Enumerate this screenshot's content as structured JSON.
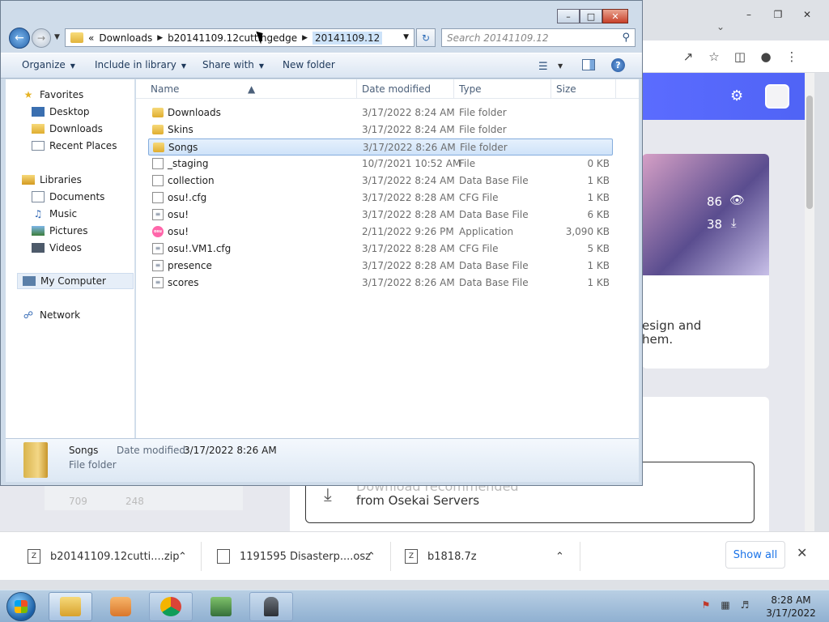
{
  "explorer": {
    "address": {
      "overflow": "«",
      "crumbs": [
        "Downloads",
        "b20141109.12cuttingedge"
      ],
      "current": "20141109.12"
    },
    "search_placeholder": "Search 20141109.12",
    "commands": {
      "organize": "Organize",
      "include": "Include in library",
      "share": "Share with",
      "new_folder": "New folder"
    },
    "nav": {
      "favorites": "Favorites",
      "desktop": "Desktop",
      "downloads": "Downloads",
      "recent": "Recent Places",
      "libraries": "Libraries",
      "documents": "Documents",
      "music": "Music",
      "pictures": "Pictures",
      "videos": "Videos",
      "computer": "My Computer",
      "network": "Network"
    },
    "columns": {
      "name": "Name",
      "date": "Date modified",
      "type": "Type",
      "size": "Size"
    },
    "files": [
      {
        "name": "Downloads",
        "date": "3/17/2022 8:24 AM",
        "type": "File folder",
        "size": "",
        "icon": "folder-icon"
      },
      {
        "name": "Skins",
        "date": "3/17/2022 8:24 AM",
        "type": "File folder",
        "size": "",
        "icon": "folder-icon"
      },
      {
        "name": "Songs",
        "date": "3/17/2022 8:26 AM",
        "type": "File folder",
        "size": "",
        "icon": "folder-icon"
      },
      {
        "name": "_staging",
        "date": "10/7/2021 10:52 AM",
        "type": "File",
        "size": "0 KB",
        "icon": "file-icon"
      },
      {
        "name": "collection",
        "date": "3/17/2022 8:24 AM",
        "type": "Data Base File",
        "size": "1 KB",
        "icon": "file-icon"
      },
      {
        "name": "osu!.cfg",
        "date": "3/17/2022 8:28 AM",
        "type": "CFG File",
        "size": "1 KB",
        "icon": "file-icon"
      },
      {
        "name": "osu!",
        "date": "3/17/2022 8:28 AM",
        "type": "Data Base File",
        "size": "6 KB",
        "icon": "database-file-icon"
      },
      {
        "name": "osu!",
        "date": "2/11/2022 9:26 PM",
        "type": "Application",
        "size": "3,090 KB",
        "icon": "osu-app-icon"
      },
      {
        "name": "osu!.VM1.cfg",
        "date": "3/17/2022 8:28 AM",
        "type": "CFG File",
        "size": "5 KB",
        "icon": "database-file-icon"
      },
      {
        "name": "presence",
        "date": "3/17/2022 8:28 AM",
        "type": "Data Base File",
        "size": "1 KB",
        "icon": "database-file-icon"
      },
      {
        "name": "scores",
        "date": "3/17/2022 8:26 AM",
        "type": "Data Base File",
        "size": "1 KB",
        "icon": "database-file-icon"
      }
    ],
    "details": {
      "name": "Songs",
      "date_label": "Date modified:",
      "date_value": "3/17/2022 8:26 AM",
      "type": "File folder"
    }
  },
  "browser": {
    "stats": {
      "views": "86",
      "downloads": "38"
    },
    "card_text_1": "esign and",
    "card_text_2": "hem.",
    "download_heading": "Download recommended",
    "download_source": "from Osekai Servers",
    "left_stats": {
      "views": "709",
      "downloads": "248"
    },
    "downloads_bar": [
      {
        "name": "b20141109.12cutti....zip"
      },
      {
        "name": "1191595 Disasterp....osz"
      },
      {
        "name": "b1818.7z"
      }
    ],
    "show_all": "Show all"
  },
  "taskbar": {
    "time": "8:28 AM",
    "date": "3/17/2022"
  }
}
